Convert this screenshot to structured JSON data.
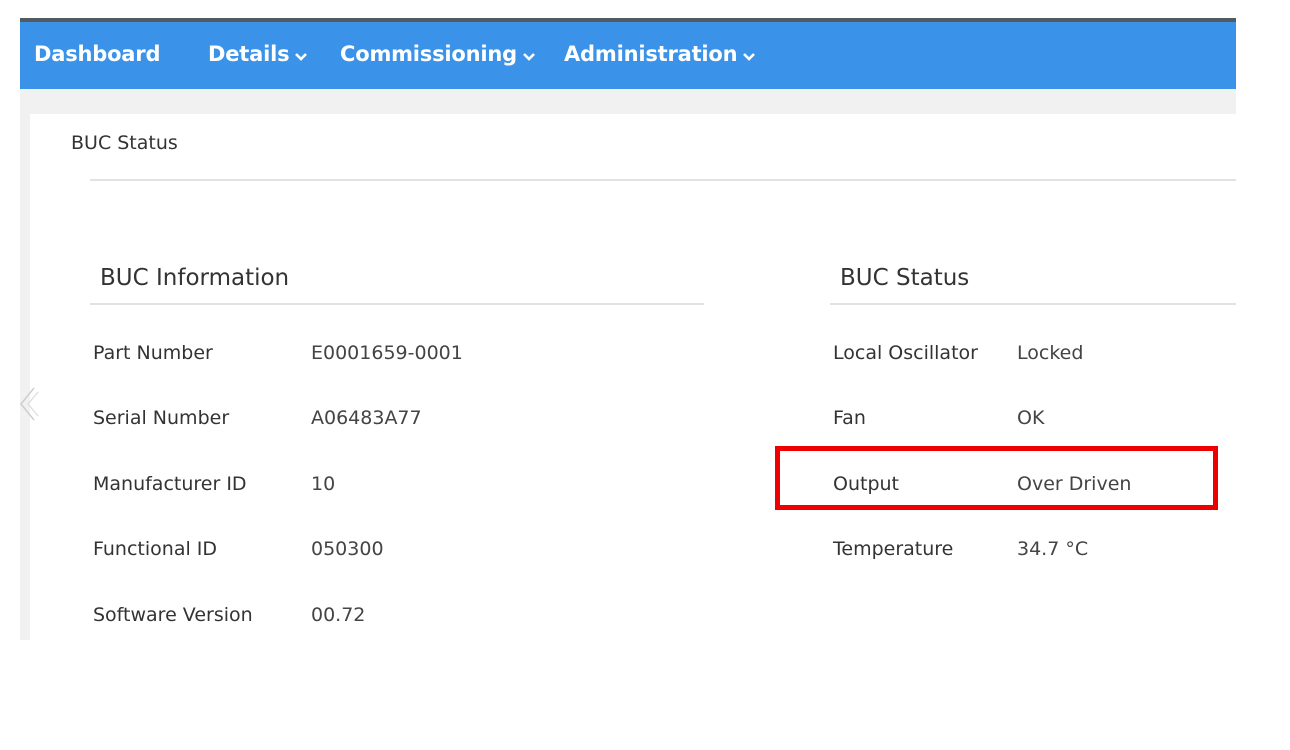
{
  "nav": {
    "items": [
      {
        "label": "Dashboard",
        "has_dropdown": false
      },
      {
        "label": "Details",
        "has_dropdown": true
      },
      {
        "label": "Commissioning",
        "has_dropdown": true
      },
      {
        "label": "Administration",
        "has_dropdown": true
      }
    ]
  },
  "breadcrumb": "BUC Status",
  "buc_information": {
    "heading": "BUC Information",
    "rows": [
      {
        "label": "Part Number",
        "value": "E0001659-0001"
      },
      {
        "label": "Serial Number",
        "value": "A06483A77"
      },
      {
        "label": "Manufacturer ID",
        "value": "10"
      },
      {
        "label": "Functional ID",
        "value": "050300"
      },
      {
        "label": "Software Version",
        "value": "00.72"
      }
    ]
  },
  "buc_status": {
    "heading": "BUC Status",
    "rows": [
      {
        "label": "Local Oscillator",
        "value": "Locked"
      },
      {
        "label": "Fan",
        "value": "OK"
      },
      {
        "label": "Output",
        "value": "Over Driven"
      },
      {
        "label": "Temperature",
        "value": "34.7 °C"
      }
    ],
    "highlighted_row": "Output"
  },
  "colors": {
    "nav_bg": "#3a93e8",
    "highlight_border": "#ee0000",
    "page_bg": "#f1f1f1"
  },
  "icons": {
    "dropdown": "chevron-down-icon",
    "carousel_prev": "chevron-left-icon"
  }
}
